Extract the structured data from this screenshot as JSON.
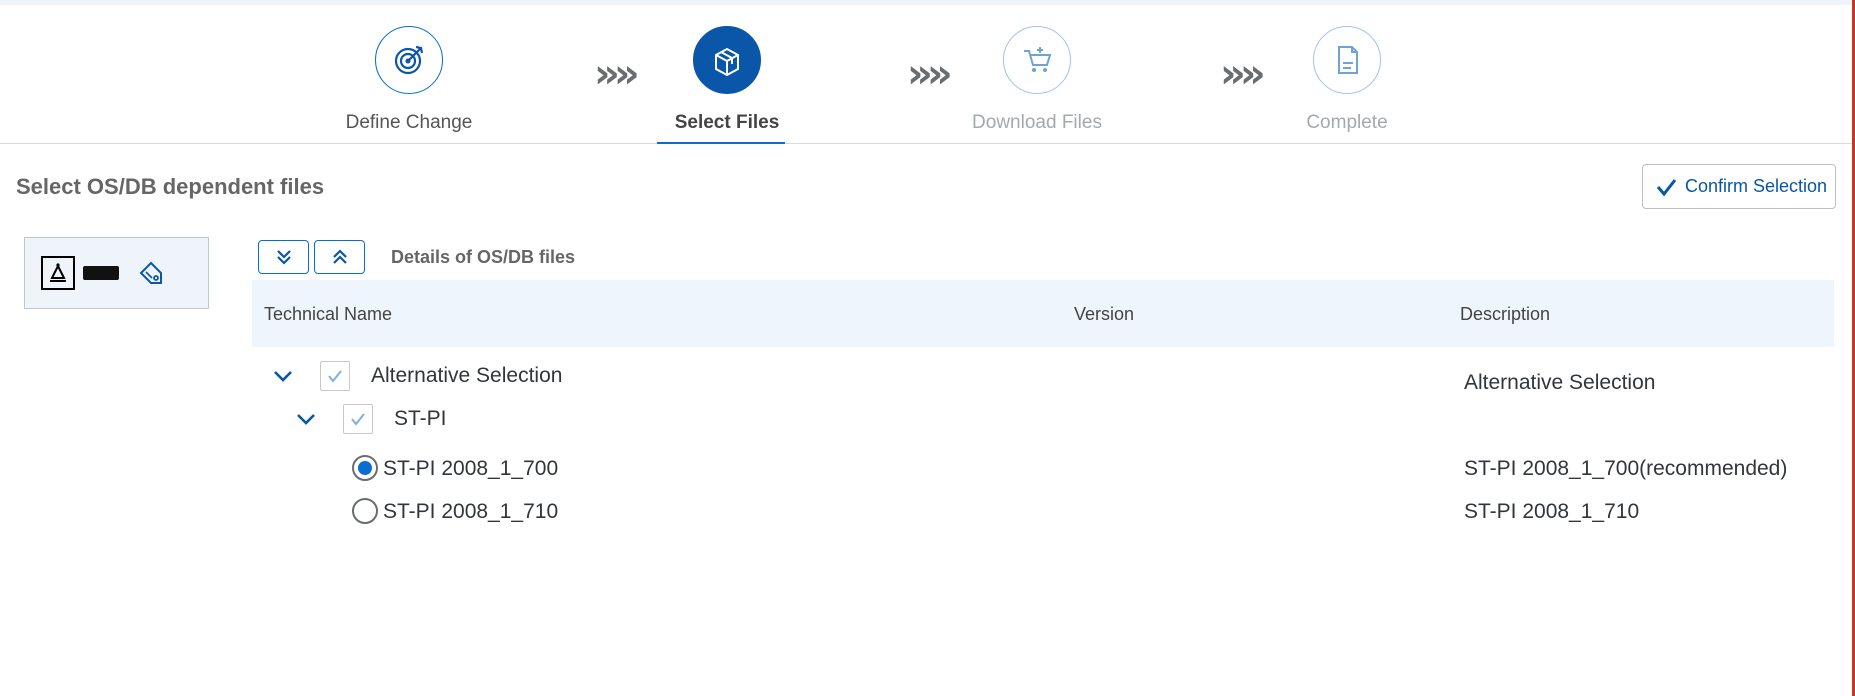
{
  "wizard": {
    "steps": [
      {
        "label": "Define Change",
        "icon": "target-icon",
        "state": "done"
      },
      {
        "label": "Select Files",
        "icon": "package-icon",
        "state": "active"
      },
      {
        "label": "Download Files",
        "icon": "cart-icon",
        "state": "future"
      },
      {
        "label": "Complete",
        "icon": "document-icon",
        "state": "future"
      }
    ],
    "separator": "»»"
  },
  "header": {
    "title": "Select OS/DB dependent files",
    "confirm_label": "Confirm Selection"
  },
  "details": {
    "title": "Details of OS/DB files",
    "expand_all_icon": "double-chevron-down-icon",
    "collapse_all_icon": "double-chevron-up-icon"
  },
  "table": {
    "columns": [
      "Technical Name",
      "Version",
      "Description"
    ],
    "rows": [
      {
        "name": "Alternative Selection",
        "description": "Alternative Selection"
      },
      {
        "name": "ST-PI",
        "description": ""
      },
      {
        "name": "ST-PI 2008_1_700",
        "description": "ST-PI 2008_1_700(recommended)",
        "selected": true
      },
      {
        "name": "ST-PI 2008_1_710",
        "description": "ST-PI 2008_1_710",
        "selected": false
      }
    ]
  },
  "colors": {
    "accent": "#0a6ed1",
    "active_step": "#0a56a8",
    "table_header_bg": "#eef5fc"
  }
}
